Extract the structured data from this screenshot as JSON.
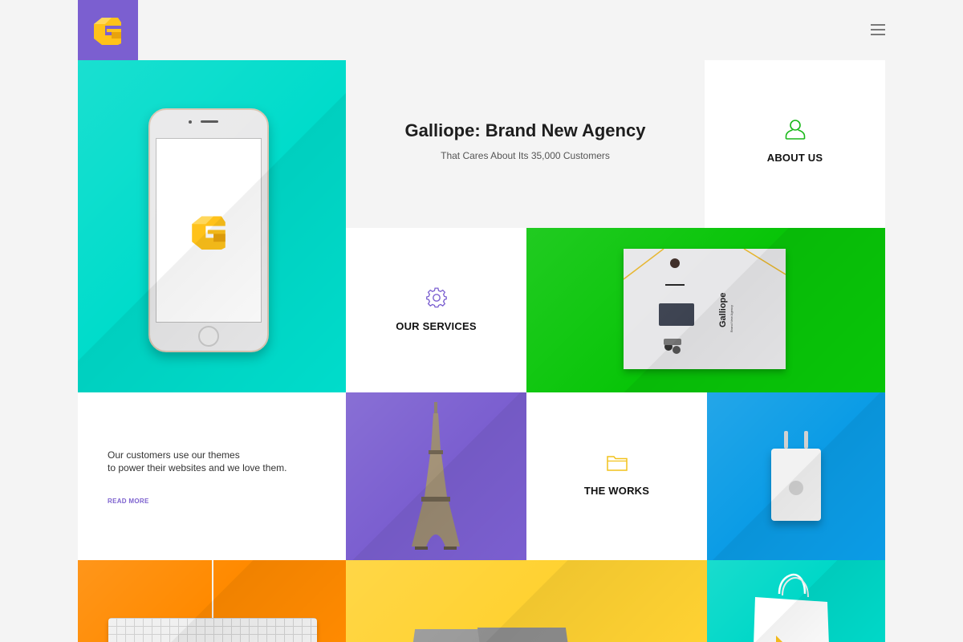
{
  "header": {
    "logo_icon": "galliope-logo-icon",
    "menu_icon": "hamburger-menu-icon"
  },
  "hero": {
    "title": "Galliope: Brand New Agency",
    "subtitle": "That Cares About Its 35,000 Customers"
  },
  "tiles": {
    "about": {
      "label": "ABOUT US",
      "icon": "user-icon"
    },
    "services": {
      "label": "OUR SERVICES",
      "icon": "gear-icon"
    },
    "works": {
      "label": "THE WORKS",
      "icon": "folder-icon"
    }
  },
  "testimonial": {
    "line1": "Our customers use our themes",
    "line2": "to power their websites and we love them.",
    "read_more": "READ MORE"
  },
  "brochure": {
    "title": "Galliope",
    "subtitle": "Brand New Agency"
  },
  "colors": {
    "background": "#f4f4f4",
    "logo_tile": "#7b5fd0",
    "cyan": "#00dccb",
    "green": "#08c508",
    "purple": "#7b5fd0",
    "blue": "#0b9ce6",
    "orange": "#ff8a00",
    "yellow": "#ffd232",
    "teal": "#00d8c8",
    "brand_yellow": "#ffc21a",
    "read_more": "#7d62cf"
  }
}
